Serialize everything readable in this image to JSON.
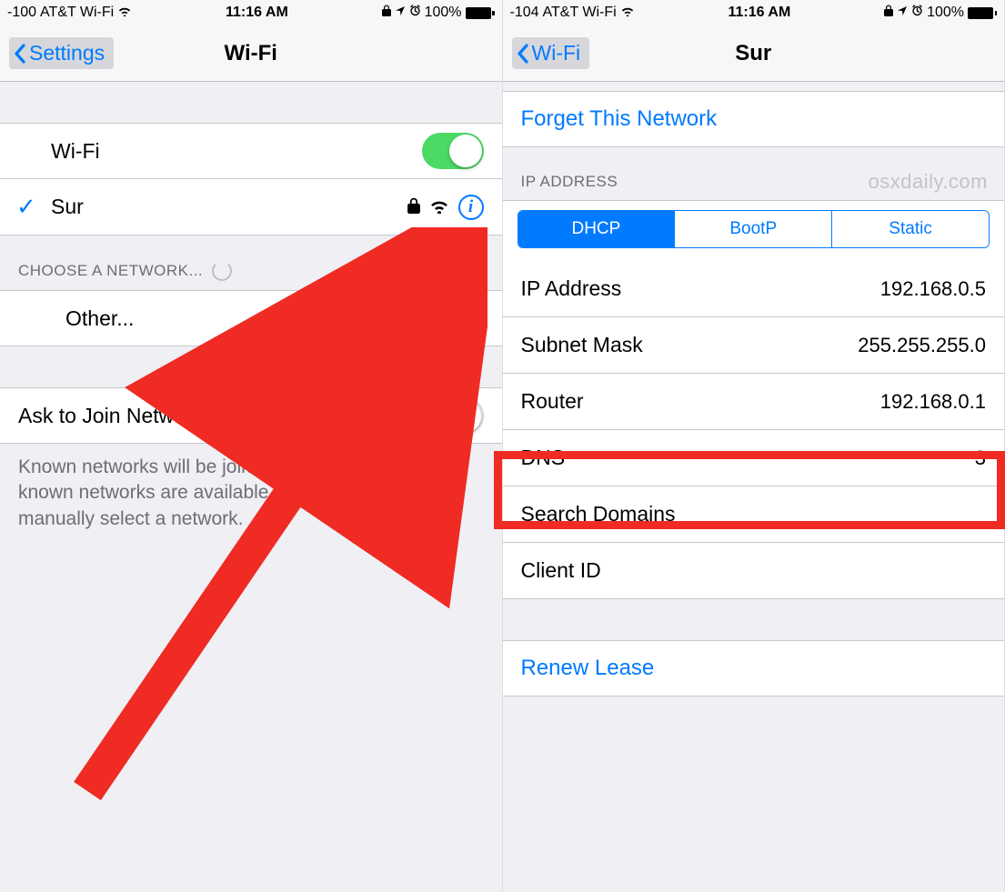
{
  "left": {
    "status": {
      "signal": "-100",
      "carrier": "AT&T Wi-Fi",
      "time": "11:16 AM",
      "battery_pct": "100%"
    },
    "nav": {
      "back": "Settings",
      "title": "Wi-Fi"
    },
    "wifi_label": "Wi-Fi",
    "wifi_on": true,
    "connected_network": "Sur",
    "choose_header": "CHOOSE A NETWORK...",
    "other_label": "Other...",
    "ask_label": "Ask to Join Networks",
    "ask_footer": "Known networks will be joined automatically. If no known networks are available, you will have to manually select a network."
  },
  "right": {
    "status": {
      "signal": "-104",
      "carrier": "AT&T Wi-Fi",
      "time": "11:16 AM",
      "battery_pct": "100%"
    },
    "nav": {
      "back": "Wi-Fi",
      "title": "Sur"
    },
    "forget_label": "Forget This Network",
    "ip_header": "IP ADDRESS",
    "watermark": "osxdaily.com",
    "segments": {
      "dhcp": "DHCP",
      "bootp": "BootP",
      "static": "Static"
    },
    "rows": {
      "ip_label": "IP Address",
      "ip_value": "192.168.0.5",
      "subnet_label": "Subnet Mask",
      "subnet_value": "255.255.255.0",
      "router_label": "Router",
      "router_value": "192.168.0.1",
      "dns_label": "DNS",
      "dns_value": "3",
      "search_label": "Search Domains",
      "search_value": "",
      "client_label": "Client ID",
      "client_value": ""
    },
    "renew_label": "Renew Lease"
  }
}
